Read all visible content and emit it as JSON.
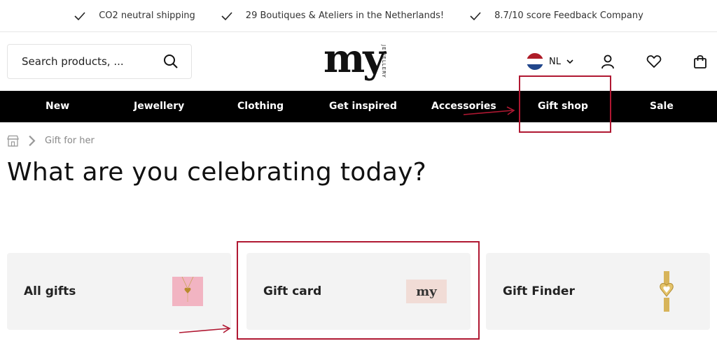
{
  "usps": [
    {
      "icon": "check-icon",
      "text": "CO2 neutral shipping"
    },
    {
      "icon": "check-icon",
      "text": "29 Boutiques & Ateliers in the Netherlands!"
    },
    {
      "icon": "check-icon",
      "text": "8.7/10 score Feedback Company"
    }
  ],
  "search": {
    "placeholder": "Search products, ..."
  },
  "logo": {
    "word": "my",
    "sub": "JEWELLERY"
  },
  "language": {
    "code": "NL"
  },
  "nav": [
    "New",
    "Jewellery",
    "Clothing",
    "Get inspired",
    "Accessories",
    "Gift shop",
    "Sale"
  ],
  "breadcrumb": {
    "current": "Gift for her"
  },
  "page_title": "What are you celebrating today?",
  "cards": [
    {
      "label": "All gifts"
    },
    {
      "label": "Gift card",
      "thumb_text": "my"
    },
    {
      "label": "Gift Finder"
    }
  ],
  "colors": {
    "annotation": "#b01832",
    "nav_bg": "#000000",
    "card_bg": "#f3f3f3"
  }
}
